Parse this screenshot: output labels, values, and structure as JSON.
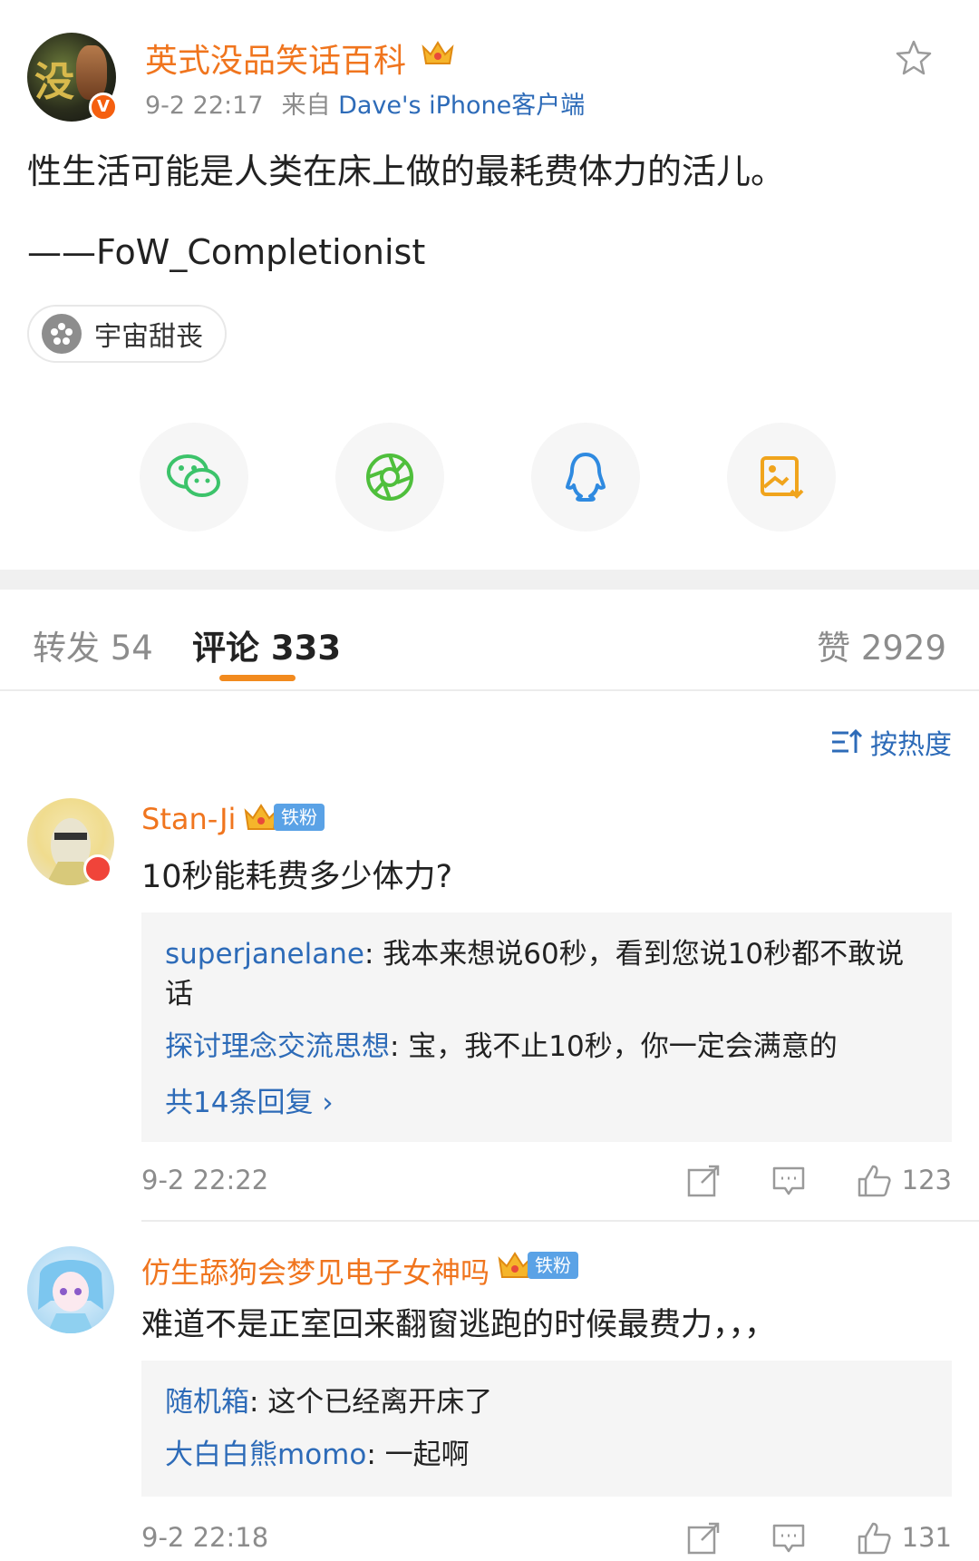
{
  "post": {
    "author": "英式没品笑话百科",
    "time": "9-2 22:17",
    "source_prefix": "来自",
    "source": "Dave's iPhone客户端",
    "text": "性生活可能是人类在床上做的最耗费体力的活儿。",
    "attribution": "——FoW_Completionist",
    "topic": "宇宙甜丧",
    "verified_badge": "V"
  },
  "share": {
    "icons": [
      "wechat-icon",
      "moments-icon",
      "qq-icon",
      "save-image-icon"
    ],
    "colors": {
      "wechat": "#3cc36a",
      "moments": "#4fbf3c",
      "qq": "#2f8ae0",
      "save": "#f0a41c"
    }
  },
  "tabs": {
    "repost": "转发 54",
    "comment": "评论 333",
    "like": "赞 2929"
  },
  "sort": {
    "label": "按热度"
  },
  "comments": [
    {
      "user": "Stan-Ji",
      "badge": "铁粉",
      "text": "10秒能耗费多少体力?",
      "replies": [
        {
          "user": "superjanelane",
          "sep": ":",
          "text": " 我本来想说60秒，看到您说10秒都不敢说话"
        },
        {
          "user": "探讨理念交流思想",
          "sep": ":",
          "text": " 宝，我不止10秒，你一定会满意的"
        }
      ],
      "more": "共14条回复 ›",
      "time": "9-2 22:22",
      "likes": "123"
    },
    {
      "user": "仿生舔狗会梦见电子女神吗",
      "badge": "铁粉",
      "text": "难道不是正室回来翻窗逃跑的时候最费力，，，",
      "replies": [
        {
          "user": "随机箱",
          "sep": ":",
          "text": " 这个已经离开床了"
        },
        {
          "user": "大白白熊momo",
          "sep": ":",
          "text": " 一起啊"
        }
      ],
      "time": "9-2 22:18",
      "likes": "131"
    }
  ],
  "colors": {
    "orange_name": "#f0751e",
    "link_blue": "#2d6bb8",
    "tab_underline": "#f28a1e"
  }
}
